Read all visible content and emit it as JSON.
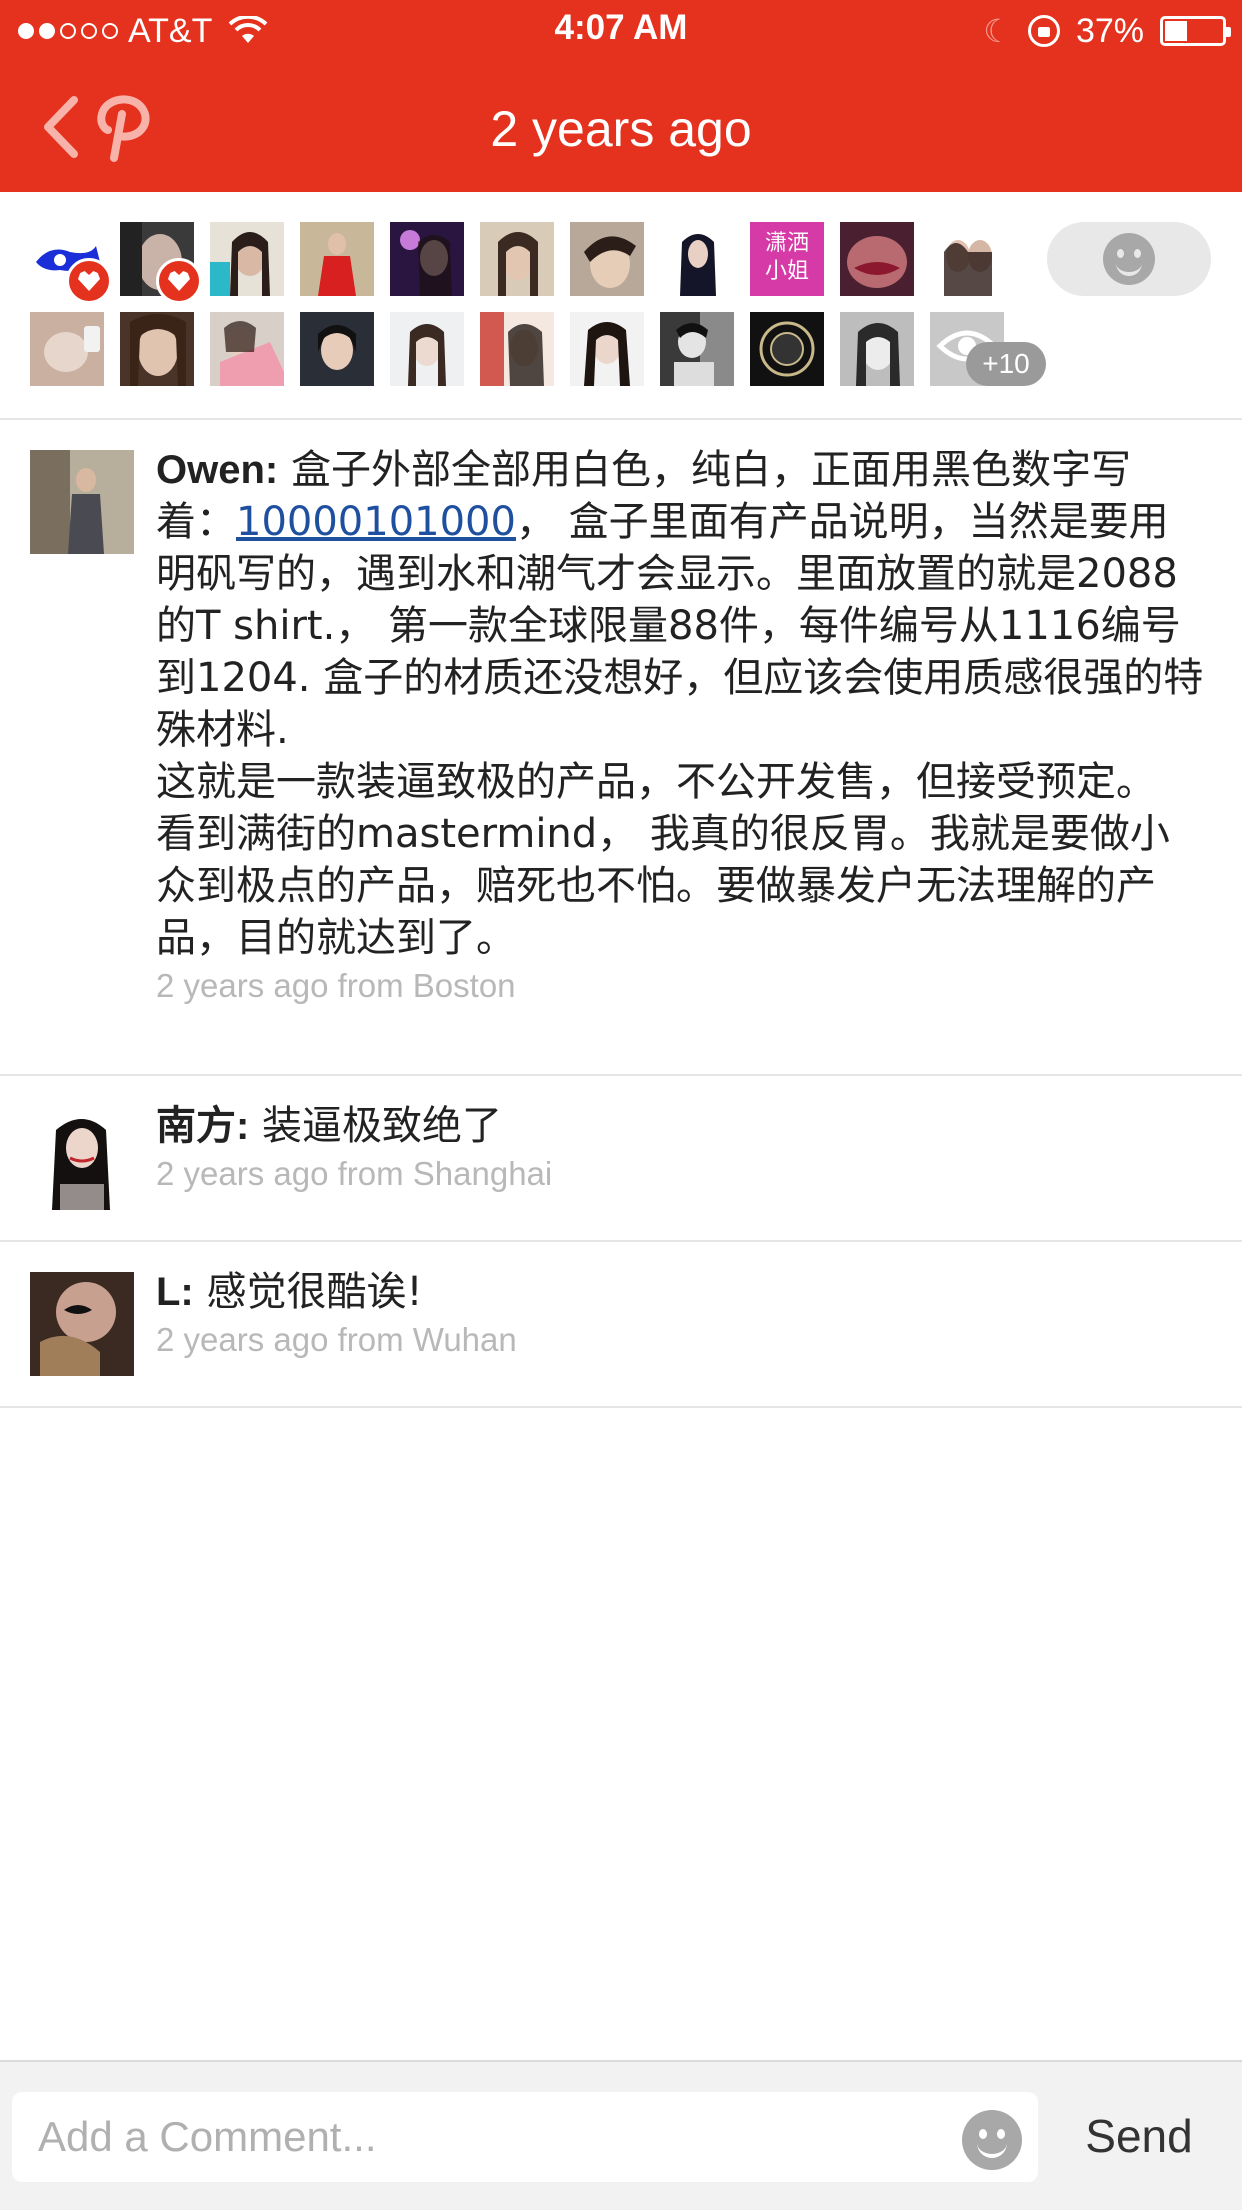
{
  "status_bar": {
    "carrier": "AT&T",
    "time": "4:07 AM",
    "battery": "37%",
    "signal_bars": 2
  },
  "nav": {
    "title": "2 years ago",
    "back_icon": "chevron-left-icon",
    "logo_icon": "pinterest-p-icon"
  },
  "likers": {
    "badge_text": "潇洒\n小姐",
    "more_count": "+10"
  },
  "comments": [
    {
      "author": "Owen:",
      "text_before_link": "盒子外部全部用白色，纯白，正面用黑色数字写着：",
      "link": "10000101000",
      "text_after_link": "， 盒子里面有产品说明，当然是要用明矾写的，遇到水和潮气才会显示。里面放置的就是2088的T shirt.， 第一款全球限量88件，每件编号从1116编号到1204. 盒子的材质还没想好，但应该会使用质感很强的特殊材料.",
      "paragraph2": "这就是一款装逼致极的产品，不公开发售，但接受预定。",
      "paragraph3": "看到满街的mastermind， 我真的很反胃。我就是要做小众到极点的产品，赔死也不怕。要做暴发户无法理解的产品，目的就达到了。",
      "meta": "2 years ago from Boston"
    },
    {
      "author": "南方:",
      "text": "装逼极致绝了",
      "meta": "2 years ago from Shanghai"
    },
    {
      "author": "L:",
      "text": "感觉很酷诶!",
      "meta": "2 years ago from Wuhan"
    }
  ],
  "input_bar": {
    "placeholder": "Add a Comment...",
    "send_label": "Send"
  },
  "colors": {
    "brand_red": "#e5321f",
    "link_blue": "#1f4f9f",
    "meta_gray": "#b8b8b8"
  }
}
